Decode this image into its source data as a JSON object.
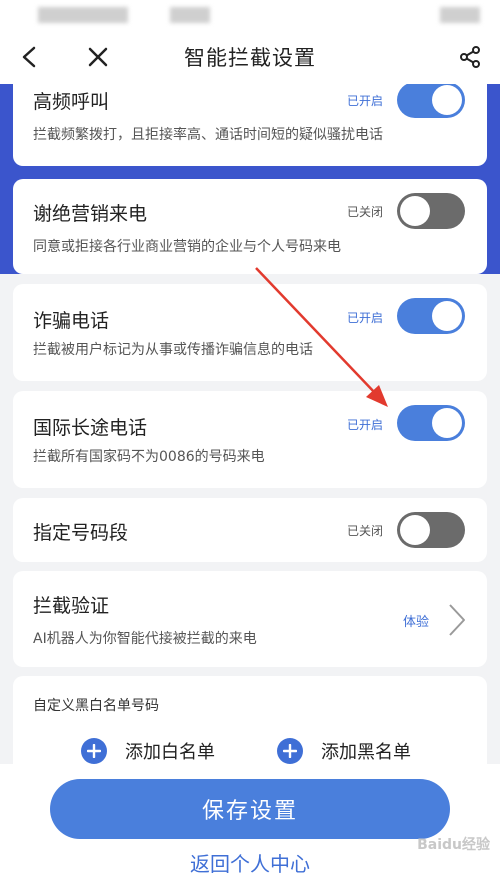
{
  "nav": {
    "title": "智能拦截设置",
    "back_icon": "back-arrow-icon",
    "close_icon": "close-icon",
    "share_icon": "share-icon"
  },
  "settings": [
    {
      "title": "高频呼叫",
      "description": "拦截频繁拨打，且拒接率高、通话时间短的疑似骚扰电话",
      "state_label": "已开启",
      "enabled": true
    },
    {
      "title": "谢绝营销来电",
      "description": "同意或拒接各行业商业营销的企业与个人号码来电",
      "state_label": "已关闭",
      "enabled": false
    },
    {
      "title": "诈骗电话",
      "description": "拦截被用户标记为从事或传播诈骗信息的电话",
      "state_label": "已开启",
      "enabled": true
    },
    {
      "title": "国际长途电话",
      "description": "拦截所有国家码不为0086的号码来电",
      "state_label": "已开启",
      "enabled": true
    },
    {
      "title": "指定号码段",
      "state_label": "已关闭",
      "enabled": false
    }
  ],
  "verify": {
    "title": "拦截验证",
    "description": "AI机器人为你智能代接被拦截的来电",
    "action_label": "体验"
  },
  "custom_list": {
    "title": "自定义黑白名单号码",
    "add_whitelist": "添加白名单",
    "add_blacklist": "添加黑名单"
  },
  "footer": {
    "save_label": "保存设置",
    "return_label": "返回个人中心"
  },
  "watermark": "Baidu经验",
  "colors": {
    "accent": "#4a7fdc",
    "header_band": "#3b55cc",
    "toggle_off": "#6b6b6b",
    "annotation_arrow": "#e23a2e"
  }
}
